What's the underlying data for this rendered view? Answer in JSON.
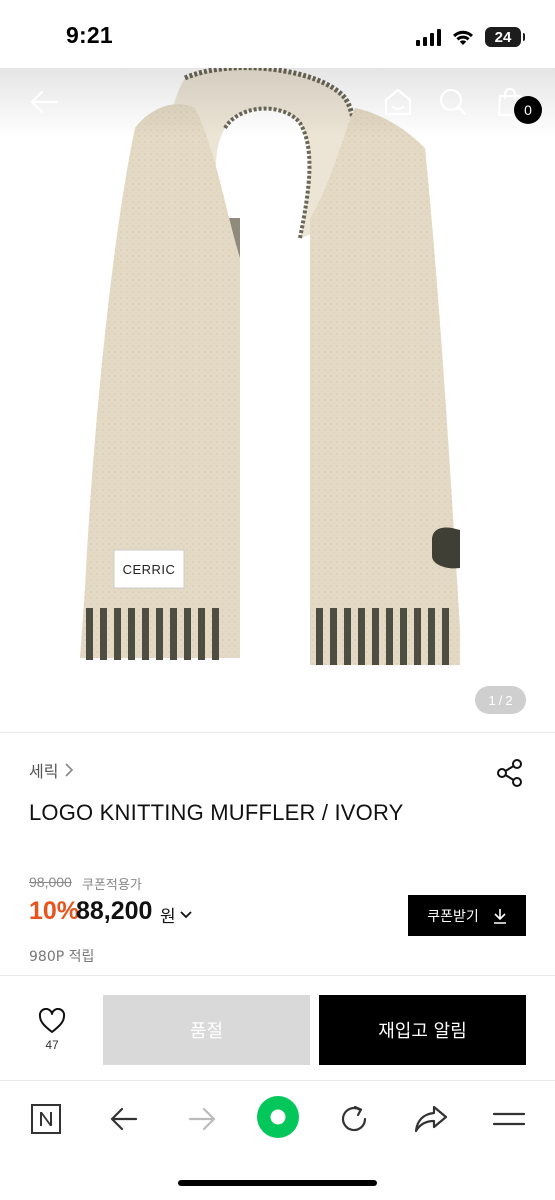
{
  "status_bar": {
    "time": "9:21",
    "battery_level": "24",
    "icons": [
      "signal-icon",
      "wifi-icon",
      "battery-icon"
    ]
  },
  "header": {
    "icons": [
      "back-arrow-icon",
      "home-icon",
      "search-icon",
      "shopping-bag-icon"
    ],
    "cart_count": "0"
  },
  "gallery": {
    "current": "1",
    "separator": "/",
    "total": "2",
    "label_on_product": "CERRIC"
  },
  "product": {
    "brand": "세릭",
    "title": "LOGO KNITTING MUFFLER / IVORY",
    "original_price": "98,000",
    "coupon_label": "쿠폰적용가",
    "discount_rate": "10%",
    "sale_price": "88,200",
    "price_unit": "원",
    "coupon_button_label": "쿠폰받기",
    "points": "980P 적립"
  },
  "action_bar": {
    "wish_count": "47",
    "soldout_label": "품절",
    "restock_label": "재입고 알림"
  },
  "browser_toolbar": {
    "icons": [
      "naver-n-icon",
      "back-icon",
      "forward-icon",
      "green-dot-icon",
      "refresh-icon",
      "share-icon",
      "menu-icon"
    ]
  },
  "colors": {
    "discount": "#e9531d",
    "black_button": "#000000",
    "soldout_button": "#d9d9d9",
    "naver_green": "#03c75a",
    "scarf_ivory": "#e3d9c4",
    "scarf_stripe": "#4d4d42"
  }
}
